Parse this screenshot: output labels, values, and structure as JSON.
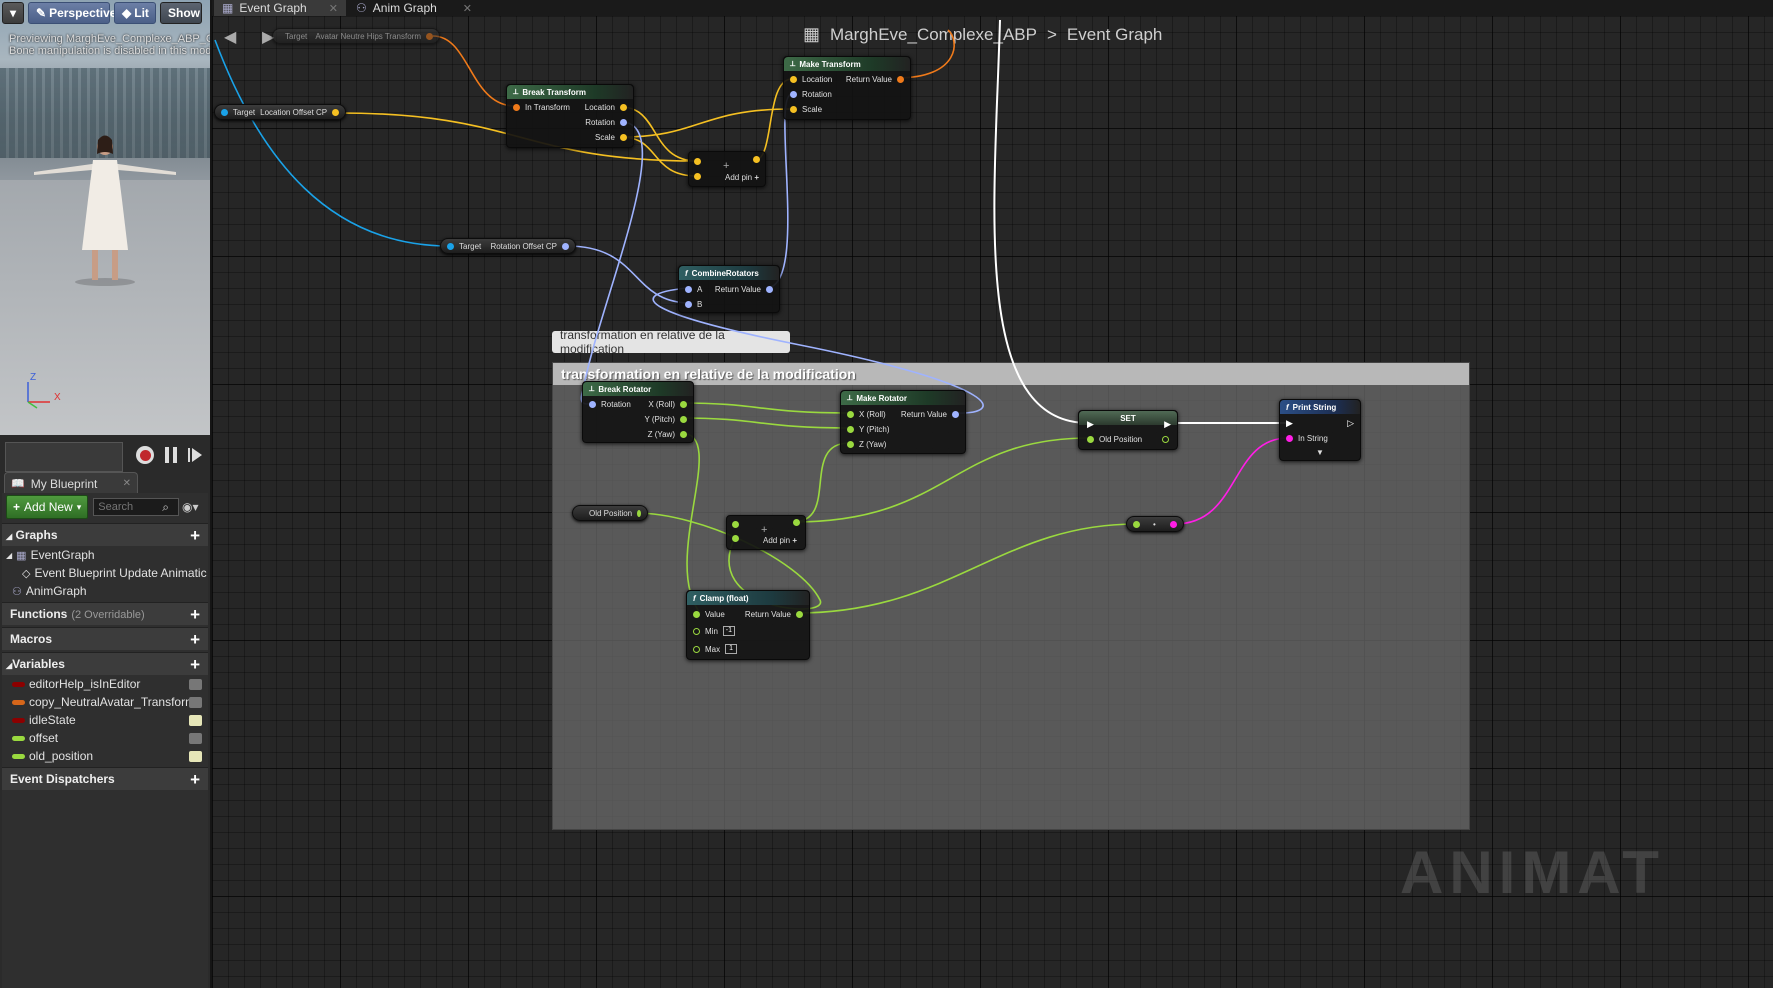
{
  "viewport": {
    "menu_glyph": "▾",
    "perspective": "Perspective",
    "lit": "Lit",
    "show": "Show",
    "status_line1": "Previewing MarghEve_Complexe_ABP_C.",
    "status_line2": "Bone manipulation is disabled in this mod",
    "axis_z": "Z",
    "axis_x": "X"
  },
  "blueprint_panel": {
    "tab_label": "My Blueprint",
    "add_new": "Add New",
    "search_placeholder": "Search",
    "graphs_header": "Graphs",
    "graph_items": [
      "EventGraph",
      "Event Blueprint Update Animatic",
      "AnimGraph"
    ],
    "functions_header": "Functions",
    "functions_count": "(2 Overridable)",
    "macros_header": "Macros",
    "variables_header": "Variables",
    "variables": [
      {
        "name": "editorHelp_isInEditor",
        "color": "#8c0000",
        "visible": false
      },
      {
        "name": "copy_NeutralAvatar_Transform",
        "color": "#d6661a",
        "visible": false
      },
      {
        "name": "idleState",
        "color": "#8c0000",
        "visible": true
      },
      {
        "name": "offset",
        "color": "#9ad93f",
        "visible": false
      },
      {
        "name": "old_position",
        "color": "#9ad93f",
        "visible": true
      }
    ],
    "dispatchers_header": "Event Dispatchers"
  },
  "tabs": [
    {
      "label": "Event Graph",
      "active": true
    },
    {
      "label": "Anim Graph",
      "active": false
    }
  ],
  "breadcrumb": {
    "blueprint": "MarghEve_Complexe_ABP",
    "separator": ">",
    "graph": "Event Graph"
  },
  "comment": {
    "bubble": "transformation en relative de la modification",
    "title": "transformation en relative de la modification"
  },
  "nodes": {
    "top_var": {
      "target": "Target",
      "value": "Avatar Neutre Hips Transform"
    },
    "location_offset": {
      "target": "Target",
      "value": "Location Offset CP"
    },
    "rotation_offset": {
      "target": "Target",
      "value": "Rotation Offset CP"
    },
    "break_transform": {
      "title": "Break Transform",
      "input": "In Transform",
      "out1": "Location",
      "out2": "Rotation",
      "out3": "Scale"
    },
    "make_transform": {
      "title": "Make Transform",
      "in1": "Location",
      "in2": "Rotation",
      "in3": "Scale",
      "out": "Return Value"
    },
    "add_top": {
      "symbol": "+",
      "add_pin": "Add pin"
    },
    "combine": {
      "title": "CombineRotators",
      "in1": "A",
      "in2": "B",
      "out": "Return Value"
    },
    "break_rotator": {
      "title": "Break Rotator",
      "input": "Rotation",
      "out1": "X (Roll)",
      "out2": "Y (Pitch)",
      "out3": "Z (Yaw)"
    },
    "make_rotator": {
      "title": "Make Rotator",
      "in1": "X (Roll)",
      "in2": "Y (Pitch)",
      "in3": "Z (Yaw)",
      "out": "Return Value"
    },
    "set": {
      "title": "SET",
      "pin": "Old Position"
    },
    "print_string": {
      "title": "Print String",
      "pin": "In String"
    },
    "old_position": {
      "value": "Old Position"
    },
    "add_mid": {
      "symbol": "+",
      "add_pin": "Add pin"
    },
    "convert": {
      "symbol": "•"
    },
    "clamp": {
      "title": "Clamp (float)",
      "in1": "Value",
      "in2": "Min",
      "min_val": "-1",
      "in3": "Max",
      "max_val": "1",
      "out": "Return Value"
    }
  },
  "watermark": "ANIMAT",
  "colors": {
    "exec": "#ffffff",
    "float": "#9ad93f",
    "vector": "#f5c022",
    "rotator": "#9fb3ff",
    "transform": "#f07a1a",
    "object": "#1aa2e8",
    "string": "#ff1ee6"
  }
}
